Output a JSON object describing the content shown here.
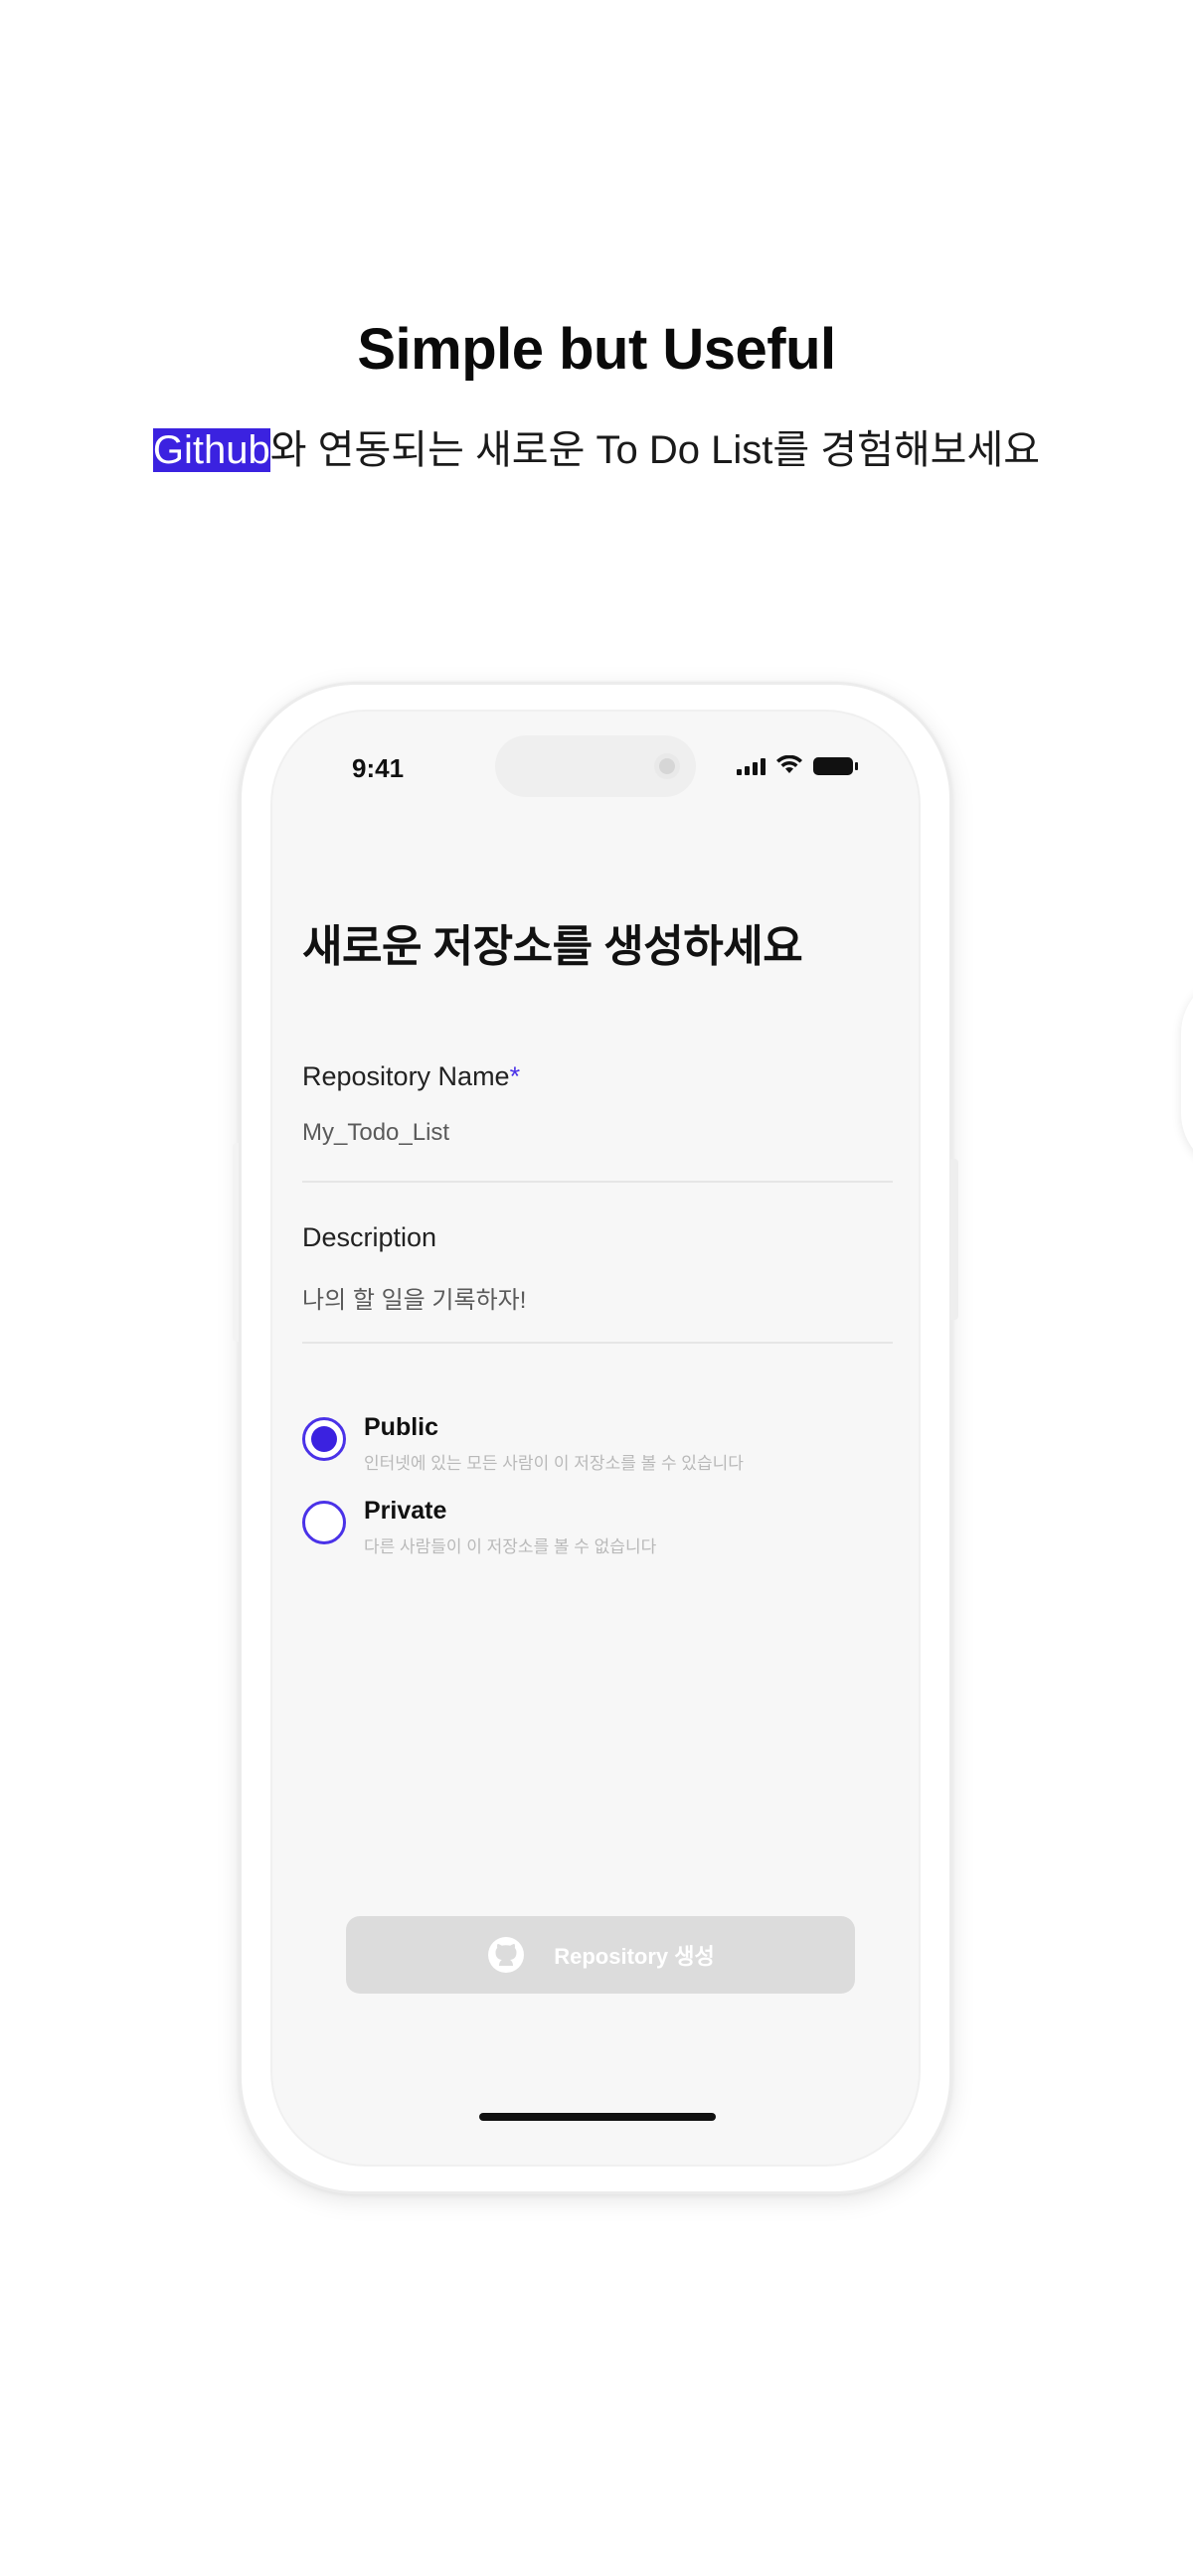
{
  "hero": {
    "title": "Simple but Useful",
    "subtitle_highlight": "Github",
    "subtitle_rest": "와 연동되는 새로운 To Do List를 경험해보세요"
  },
  "phone": {
    "status": {
      "time": "9:41",
      "icons": [
        "signal-icon",
        "wifi-icon",
        "battery-icon"
      ]
    },
    "title": "새로운 저장소를 생성하세요",
    "repo_name": {
      "label": "Repository Name",
      "required_mark": "*",
      "value": "My_Todo_List"
    },
    "description": {
      "label": "Description",
      "value": "나의 할 일을 기록하자!"
    },
    "visibility": {
      "selected": "Public",
      "options": [
        {
          "label": "Public",
          "desc": "인터넷에 있는 모든 사람이 이 저장소를 볼 수 있습니다"
        },
        {
          "label": "Private",
          "desc": "다른 사람들이 이 저장소를 볼 수 없습니다"
        }
      ]
    },
    "create_button": {
      "label": "Repository 생성",
      "icon": "github-icon"
    }
  },
  "colors": {
    "accent": "#3b22e0",
    "screen_bg": "#f7f7f7",
    "button_disabled": "#dcdcdc"
  }
}
